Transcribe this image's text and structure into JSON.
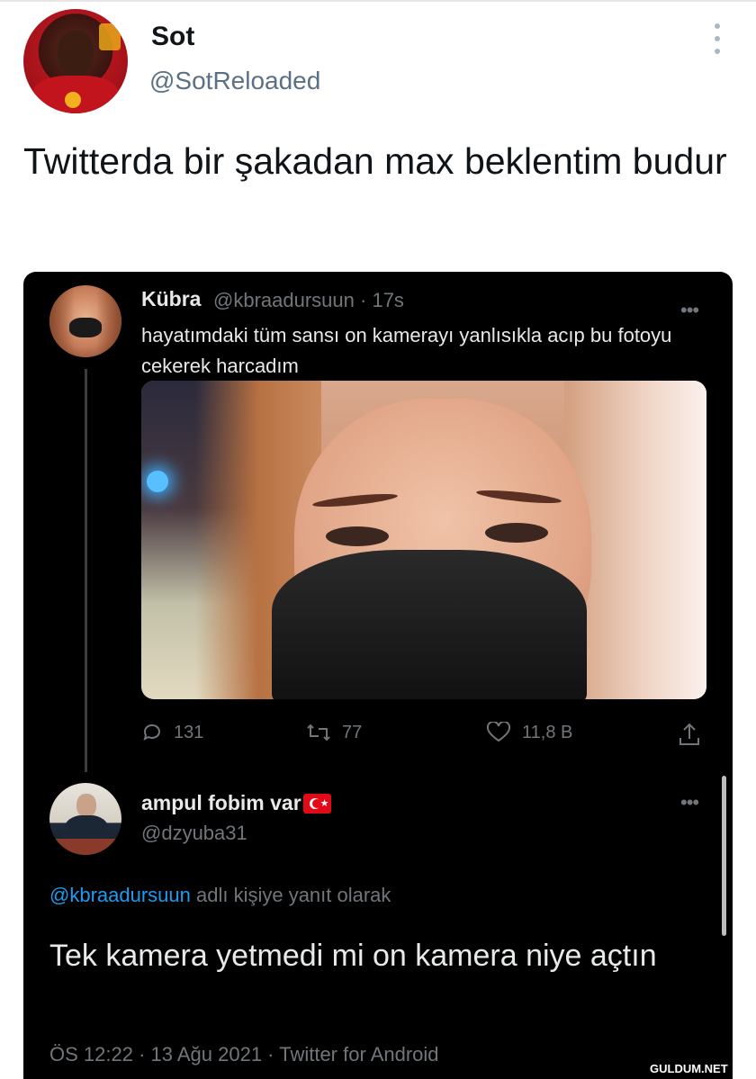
{
  "author": {
    "name": "Sot",
    "handle": "@SotReloaded"
  },
  "tweet_text": "Twitterda bir şakadan max beklentim budur",
  "quoted": {
    "name": "Kübra",
    "handle": "@kbraadursuun",
    "time_separator": "·",
    "time": "17s",
    "text": "hayatımdaki tüm sansı on kamerayı yanlısıkla acıp bu fotoyu cekerek harcadım",
    "stats": {
      "replies": "131",
      "retweets": "77",
      "likes": "11,8 B"
    },
    "more_icon": "more-horizontal-icon"
  },
  "reply": {
    "name": "ampul fobim var",
    "handle": "@dzyuba31",
    "replying_mention": "@kbraadursuun",
    "replying_suffix": " adlı kişiye yanıt olarak",
    "text": "Tek kamera yetmedi mi on kamera niye açtın",
    "meta": "ÖS 12:22 · 13 Ağu 2021 · Twitter for Android"
  },
  "watermark": "GULDUM.NET",
  "colors": {
    "accent": "#1d9bf0",
    "card_bg": "#000000",
    "muted": "#71767b",
    "flag": "#e30a17"
  }
}
